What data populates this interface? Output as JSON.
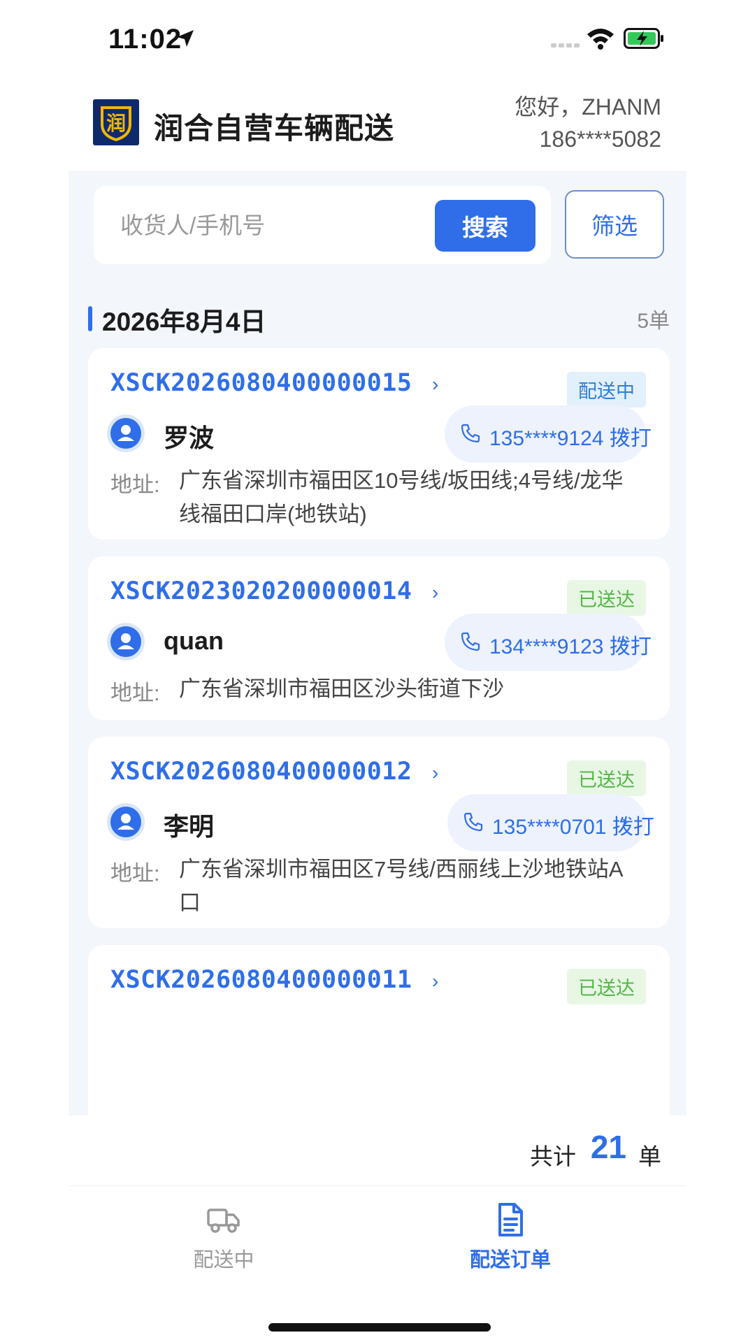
{
  "status_bar": {
    "time": "11:02"
  },
  "header": {
    "app_title": "润合自营车辆配送",
    "logo_text": "润",
    "greeting": "您好，ZHANM",
    "phone": "186****5082"
  },
  "search": {
    "placeholder": "收货人/手机号",
    "search_label": "搜索",
    "filter_label": "筛选"
  },
  "date_group": {
    "date": "2026年8月4日",
    "count": "5单"
  },
  "orders": [
    {
      "order_no": "XSCK2026080400000015",
      "status": "配送中",
      "customer": "罗波",
      "phone": "135****9124 拨打",
      "address_label": "地址:",
      "address": "广东省深圳市福田区10号线/坂田线;4号线/龙华线福田口岸(地铁站)"
    },
    {
      "order_no": "XSCK2023020200000014",
      "status": "已送达",
      "customer": "quan",
      "phone": "134****9123 拨打",
      "address_label": "地址:",
      "address": "广东省深圳市福田区沙头街道下沙"
    },
    {
      "order_no": "XSCK2026080400000012",
      "status": "已送达",
      "customer": "李明",
      "phone": "135****0701 拨打",
      "address_label": "地址:",
      "address": "广东省深圳市福田区7号线/西丽线上沙地铁站A口"
    },
    {
      "order_no": "XSCK2026080400000011",
      "status": "已送达"
    }
  ],
  "total": {
    "label": "共计",
    "count": "21",
    "unit": "单"
  },
  "tabs": [
    {
      "label": "配送中",
      "icon": "truck-icon",
      "active": false
    },
    {
      "label": "配送订单",
      "icon": "document-icon",
      "active": true
    }
  ],
  "colors": {
    "accent": "#2f6ee8",
    "delivering": "#2f7fd6",
    "delivered": "#54b646",
    "background": "#f3f6fb"
  }
}
